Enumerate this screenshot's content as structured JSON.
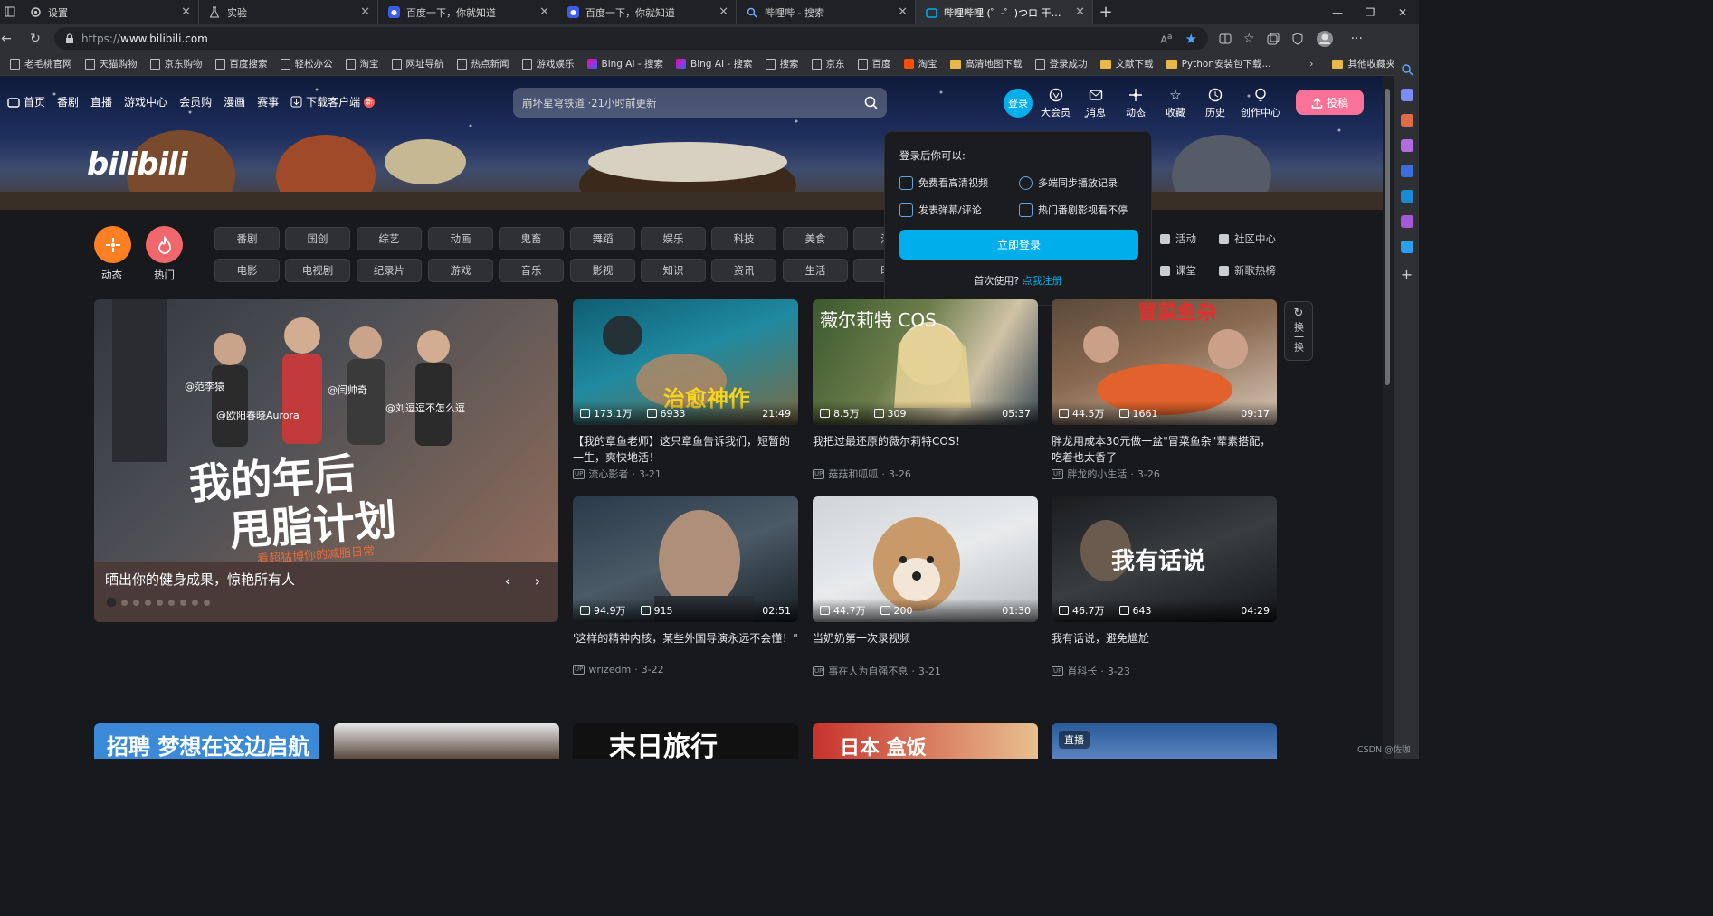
{
  "browser": {
    "tabs": [
      {
        "title": "设置",
        "icon": "gear-icon"
      },
      {
        "title": "实验",
        "icon": "flask-icon"
      },
      {
        "title": "百度一下，你就知道",
        "icon": "baidu-icon"
      },
      {
        "title": "百度一下，你就知道",
        "icon": "baidu-icon"
      },
      {
        "title": "哔哩哔 - 搜索",
        "icon": "search-icon"
      },
      {
        "title": "哔哩哔哩 (゜-゜)つロ 干杯~-bilibili",
        "icon": "bilibili-icon",
        "active": true
      }
    ],
    "url_scheme": "https://",
    "url_host": "www.bilibili.com",
    "bookmarks": [
      "老毛桃官网",
      "天猫购物",
      "京东购物",
      "百度搜索",
      "轻松办公",
      "淘宝",
      "网址导航",
      "热点新闻",
      "游戏娱乐",
      "Bing AI - 搜索",
      "Bing AI - 搜索",
      "搜索",
      "京东",
      "百度",
      "淘宝",
      "高清地图下载",
      "登录成功",
      "文献下载",
      "Python安装包下载..."
    ],
    "other_bookmarks": "其他收藏夹"
  },
  "header": {
    "nav_left": [
      "首页",
      "番剧",
      "直播",
      "游戏中心",
      "会员购",
      "漫画",
      "赛事",
      "下载客户端"
    ],
    "download_badge": "新",
    "search_placeholder": "崩坏星穹铁道 ·21小时前更新",
    "logo": "bilibili",
    "login": "登录",
    "nav_right": [
      "大会员",
      "消息",
      "动态",
      "收藏",
      "历史",
      "创作中心"
    ],
    "upload": "投稿"
  },
  "login_popup": {
    "title": "登录后你可以:",
    "features": [
      "免费看高清视频",
      "多端同步播放记录",
      "发表弹幕/评论",
      "热门番剧影视看不停"
    ],
    "login_button": "立即登录",
    "first_time": "首次使用?",
    "register": "点我注册"
  },
  "channels": {
    "dynamic": "动态",
    "hot": "热门",
    "row1": [
      "番剧",
      "国创",
      "综艺",
      "动画",
      "鬼畜",
      "舞蹈",
      "娱乐",
      "科技",
      "美食",
      "汽"
    ],
    "row2": [
      "电影",
      "电视剧",
      "纪录片",
      "游戏",
      "音乐",
      "影视",
      "知识",
      "资讯",
      "生活",
      "时"
    ],
    "side": [
      "活动",
      "社区中心",
      "课堂",
      "新歌热榜"
    ]
  },
  "carousel": {
    "title": "晒出你的健身成果，惊艳所有人",
    "overlay_line1": "我的年后",
    "overlay_line2": "甩脂计划",
    "overlay_sub": "看超猛博你的减脂日常",
    "tags": [
      "@范李猿",
      "@欧阳春晓Aurora",
      "@闫帅奇",
      "@刘逗逗不怎么逗"
    ]
  },
  "refresh": "换一换",
  "videos": [
    {
      "views": "173.1万",
      "danmaku": "6933",
      "duration": "21:49",
      "title": "【我的章鱼老师】这只章鱼告诉我们，短暂的一生，爽快地活！",
      "author": "流心影者",
      "date": "3-21",
      "overlay": "治愈神作"
    },
    {
      "views": "8.5万",
      "danmaku": "309",
      "duration": "05:37",
      "title": "我把过最还原的薇尔莉特COS！",
      "author": "菇菇和呱呱",
      "date": "3-26",
      "overlay": "薇尔莉特 COS"
    },
    {
      "views": "44.5万",
      "danmaku": "1661",
      "duration": "09:17",
      "title": "胖龙用成本30元做一盆\"冒菜鱼杂\"荤素搭配，吃着也太香了",
      "author": "胖龙的小生活",
      "date": "3-26",
      "overlay": "冒菜鱼杂"
    },
    {
      "views": "94.9万",
      "danmaku": "915",
      "duration": "02:51",
      "title": "'这样的精神内核，某些外国导演永远不会懂！\"",
      "author": "wrizedm",
      "date": "3-22",
      "overlay": ""
    },
    {
      "views": "44.7万",
      "danmaku": "200",
      "duration": "01:30",
      "title": "当奶奶第一次录视频",
      "author": "事在人为自强不息",
      "date": "3-21",
      "overlay": ""
    },
    {
      "views": "46.7万",
      "danmaku": "643",
      "duration": "04:29",
      "title": "我有话说，避免尴尬",
      "author": "肖科长",
      "date": "3-23",
      "overlay": "我有话说"
    }
  ],
  "bottom_row": {
    "c1": "招聘 梦想在这边启航",
    "c3": "末日旅行",
    "c4": "日本 盒饭",
    "c5": "直播"
  },
  "watermark": "CSDN @佐咖"
}
